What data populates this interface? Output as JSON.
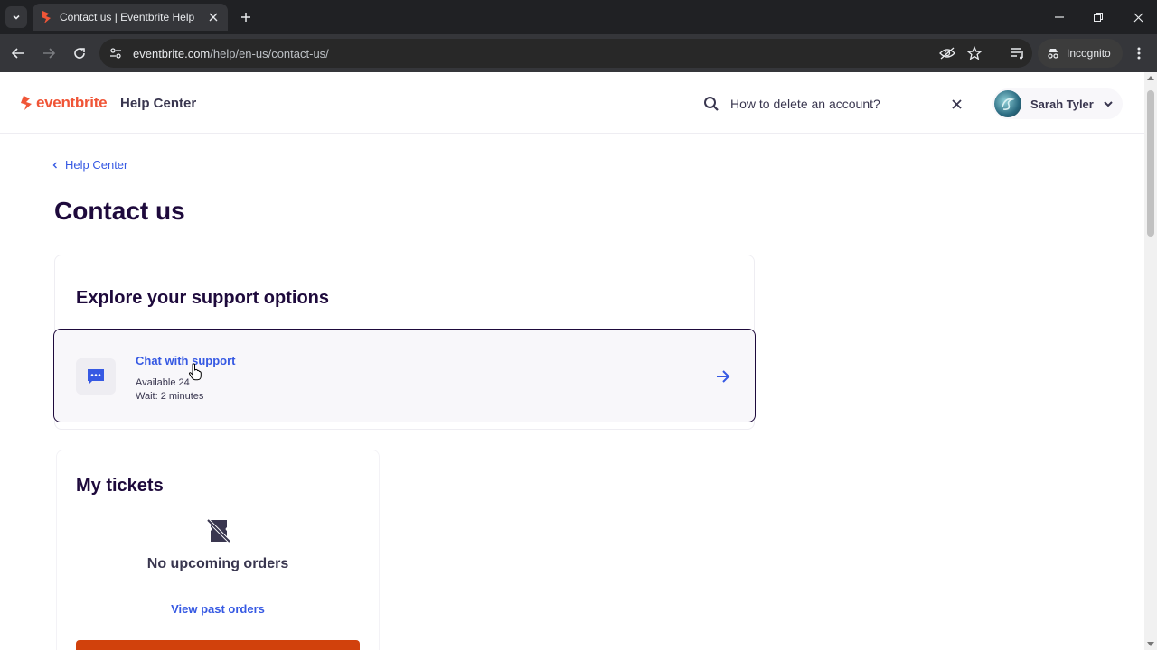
{
  "browser": {
    "tab_title": "Contact us | Eventbrite Help Ce",
    "url_host": "eventbrite.com",
    "url_path": "/help/en-us/contact-us/",
    "incognito_label": "Incognito"
  },
  "header": {
    "logo_text": "eventbrite",
    "title": "Help Center",
    "search_value": "How to delete an account?",
    "user_name": "Sarah Tyler"
  },
  "breadcrumb": {
    "label": "Help Center"
  },
  "page_title": "Contact us",
  "support": {
    "heading": "Explore your support options",
    "chat_title": "Chat with support",
    "chat_availability": "Available 24",
    "chat_wait": "Wait: 2 minutes"
  },
  "tickets": {
    "heading": "My tickets",
    "empty_text": "No upcoming orders",
    "past_orders_link": "View past orders"
  },
  "colors": {
    "brand": "#f05537",
    "link": "#3659e3",
    "heading": "#1e0a3c",
    "cta": "#d1410c"
  }
}
